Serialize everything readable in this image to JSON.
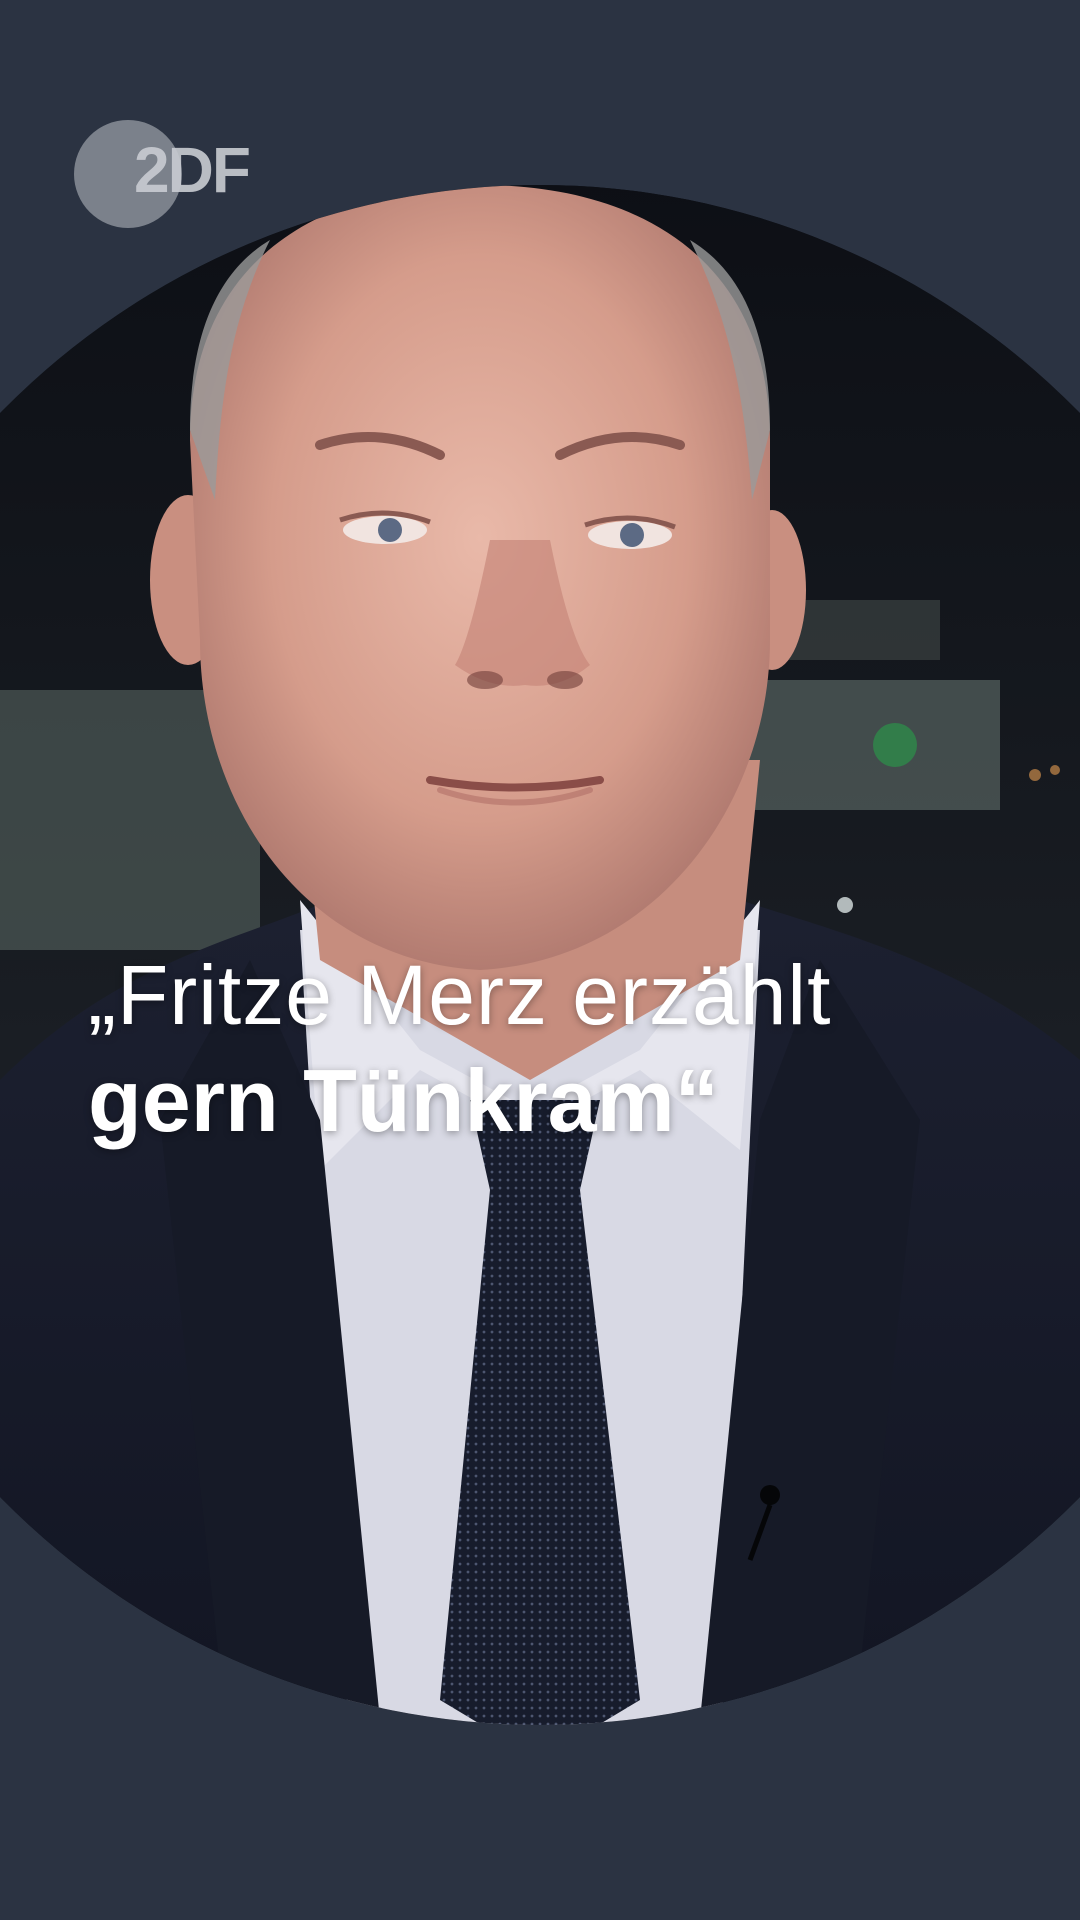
{
  "brand": {
    "logo_text": "2DF",
    "logo_icon": "zdf-logo-icon"
  },
  "quote": {
    "line1": "„Fritze Merz erzählt",
    "line2": "gern Tünkram“"
  },
  "colors": {
    "background": "#2b3342",
    "text": "#ffffff",
    "logo": "#c9ccd2"
  }
}
